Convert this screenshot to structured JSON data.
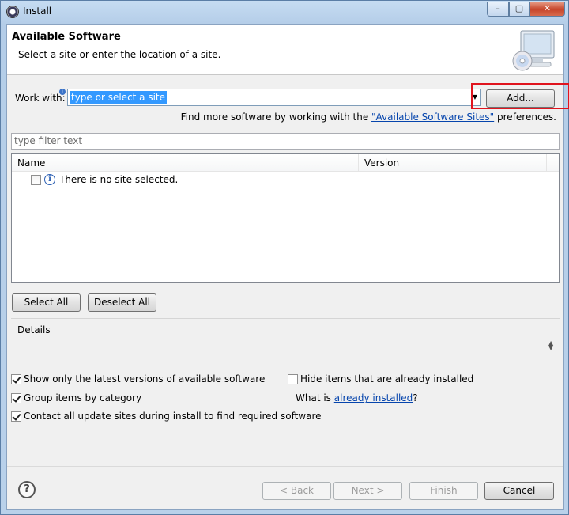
{
  "window": {
    "title": "Install",
    "minimize": "–",
    "maximize": "▢",
    "close": "✕"
  },
  "header": {
    "title": "Available Software",
    "subtitle": "Select a site or enter the location of a site."
  },
  "work_with": {
    "label": "Work with:",
    "value": "type or select a site",
    "add_label": "Add..."
  },
  "find_more": {
    "prefix": "Find more software by working with the ",
    "link": "\"Available Software Sites\"",
    "suffix": " preferences."
  },
  "filter": {
    "placeholder": "type filter text"
  },
  "tree": {
    "columns": [
      "Name",
      "Version"
    ],
    "rows": [
      {
        "label": "There is no site selected.",
        "checked": false
      }
    ]
  },
  "selection_buttons": {
    "select_all": "Select All",
    "deselect_all": "Deselect All"
  },
  "details": {
    "label": "Details"
  },
  "options": {
    "latest_versions": {
      "label": "Show only the latest versions of available software",
      "checked": true
    },
    "group_by_category": {
      "label": "Group items by category",
      "checked": true
    },
    "contact_sites": {
      "label": "Contact all update sites during install to find required software",
      "checked": true
    },
    "hide_installed": {
      "label": "Hide items that are already installed",
      "checked": false
    }
  },
  "what_installed": {
    "prefix": "What is ",
    "link": "already installed",
    "suffix": "?"
  },
  "footer": {
    "help": "?",
    "back": "< Back",
    "next": "Next >",
    "finish": "Finish",
    "cancel": "Cancel"
  },
  "colors": {
    "highlight": "#e0141e",
    "selection": "#3399ff",
    "link": "#0645ad"
  }
}
